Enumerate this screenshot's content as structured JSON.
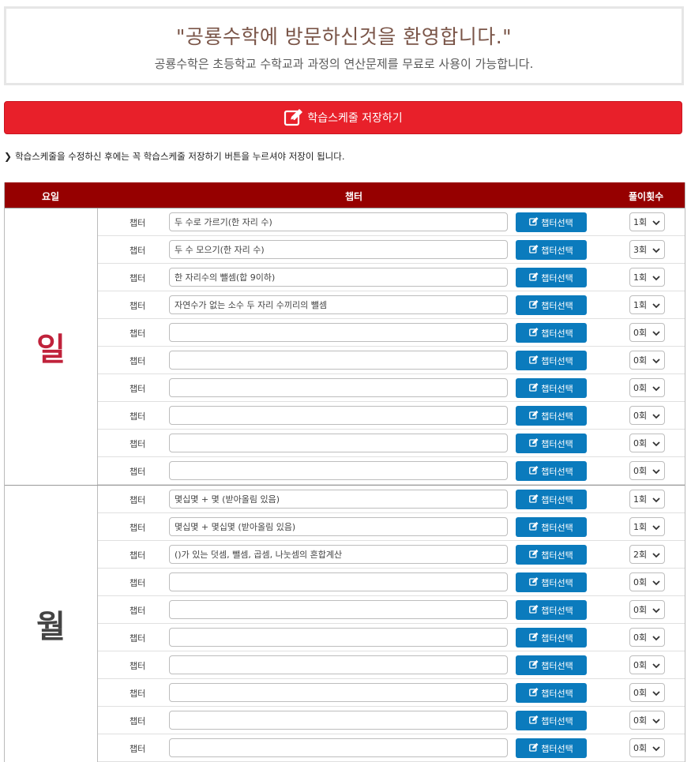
{
  "welcome": {
    "title": "\"공룡수학에 방문하신것을 환영합니다.\"",
    "subtitle": "공룡수학은 초등학교 수학교과 과정의 연산문제를 무료로 사용이 가능합니다."
  },
  "save_button": {
    "label": "학습스케줄 저장하기",
    "icon": "edit-icon"
  },
  "notice": {
    "icon": "chevron-right-icon",
    "text": "학습스케줄을 수정하신 후에는 꼭 학습스케줄 저장하기 버튼을 누르셔야 저장이 됩니다."
  },
  "table": {
    "headers": {
      "day": "요일",
      "chapter": "챕터",
      "count": "풀이횟수"
    },
    "row_label": "챕터",
    "pick_label": "챕터선택",
    "pick_icon": "edit-icon",
    "days": [
      {
        "name": "일",
        "color": "#c0223b",
        "rows": [
          {
            "chapter": "두 수로 가르기(한 자리 수)",
            "count": "1회"
          },
          {
            "chapter": "두 수 모으기(한 자리 수)",
            "count": "3회"
          },
          {
            "chapter": "한 자리수의 뺄셈(합 9이하)",
            "count": "1회"
          },
          {
            "chapter": "자연수가 없는 소수 두 자리 수끼리의 뺄셈",
            "count": "1회"
          },
          {
            "chapter": "",
            "count": "0회"
          },
          {
            "chapter": "",
            "count": "0회"
          },
          {
            "chapter": "",
            "count": "0회"
          },
          {
            "chapter": "",
            "count": "0회"
          },
          {
            "chapter": "",
            "count": "0회"
          },
          {
            "chapter": "",
            "count": "0회"
          }
        ]
      },
      {
        "name": "월",
        "color": "#444444",
        "rows": [
          {
            "chapter": "몇십몇 + 몇 (받아올림 있음)",
            "count": "1회"
          },
          {
            "chapter": "몇십몇 + 몇십몇 (받아올림 있음)",
            "count": "1회"
          },
          {
            "chapter": "()가 있는 덧셈, 뺄셈, 곱셈, 나눗셈의 혼합계산",
            "count": "2회"
          },
          {
            "chapter": "",
            "count": "0회"
          },
          {
            "chapter": "",
            "count": "0회"
          },
          {
            "chapter": "",
            "count": "0회"
          },
          {
            "chapter": "",
            "count": "0회"
          },
          {
            "chapter": "",
            "count": "0회"
          },
          {
            "chapter": "",
            "count": "0회"
          },
          {
            "chapter": "",
            "count": "0회"
          }
        ]
      }
    ]
  }
}
